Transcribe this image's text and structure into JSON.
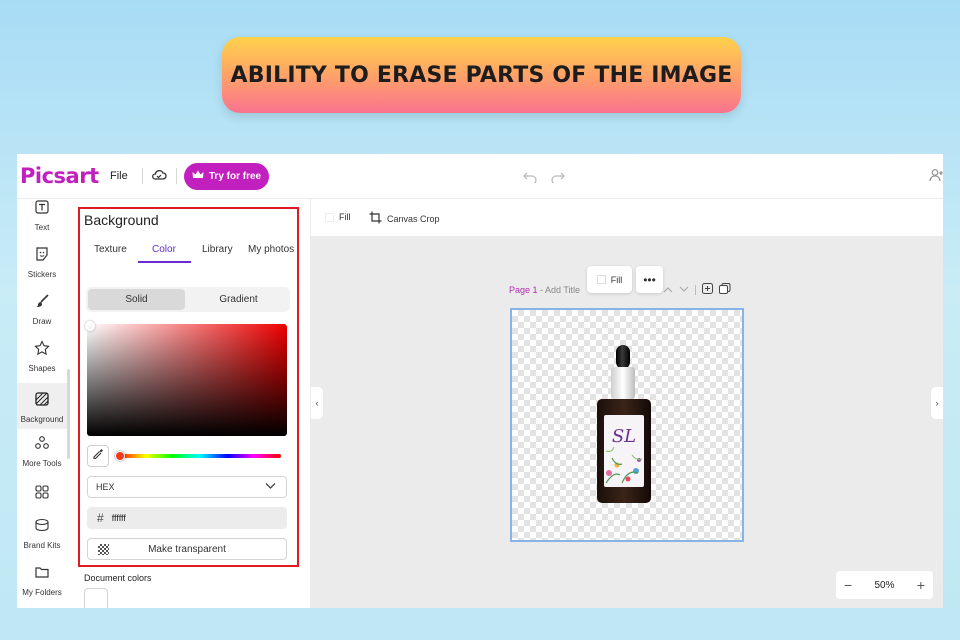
{
  "banner": {
    "text": "ABILITY TO ERASE PARTS OF THE IMAGE"
  },
  "topbar": {
    "logo": "Picsart",
    "file_label": "File",
    "try_label": "Try for free"
  },
  "rail": {
    "items": [
      {
        "label": "Text",
        "icon": "text-icon"
      },
      {
        "label": "Stickers",
        "icon": "sticker-icon"
      },
      {
        "label": "Draw",
        "icon": "brush-icon"
      },
      {
        "label": "Shapes",
        "icon": "star-icon"
      },
      {
        "label": "Background",
        "icon": "background-icon"
      },
      {
        "label": "More Tools",
        "icon": "more-tools-icon"
      },
      {
        "label": "",
        "icon": "grid-icon"
      },
      {
        "label": "Brand Kits",
        "icon": "brand-kit-icon"
      },
      {
        "label": "My Folders",
        "icon": "folder-icon"
      }
    ]
  },
  "panel": {
    "title": "Background",
    "tabs": [
      "Texture",
      "Color",
      "Library",
      "My photos"
    ],
    "active_tab": "Color",
    "segments": [
      "Solid",
      "Gradient"
    ],
    "active_segment": "Solid",
    "format": "HEX",
    "hex_value": "ffffff",
    "transparent_label": "Make transparent",
    "doc_colors_label": "Document colors",
    "accent": "#6a2bd1",
    "highlight": "#e01b24"
  },
  "toolbar": {
    "fill_label": "Fill",
    "crop_label": "Canvas Crop"
  },
  "canvas": {
    "page_number": "Page 1",
    "page_title_placeholder": "Add Title",
    "float_fill_label": "Fill",
    "zoom": "50%",
    "brand": "#c21fbf"
  }
}
